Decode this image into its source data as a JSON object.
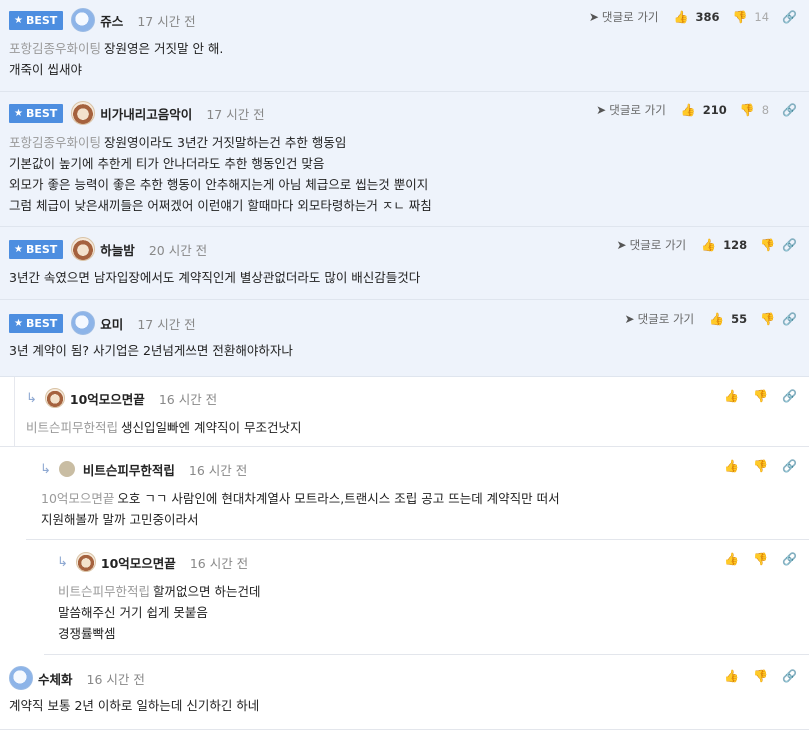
{
  "ui": {
    "best_label": "BEST",
    "reply_label": "댓글로 가기"
  },
  "comments": [
    {
      "nick": "쥬스",
      "time": "17 시간 전",
      "up": "386",
      "down": "14",
      "ref": "포항김종우화이팅",
      "lines": [
        "장원영은 거짓말 안 해.",
        "개죽이 씹새야"
      ]
    },
    {
      "nick": "비가내리고음악이",
      "time": "17 시간 전",
      "up": "210",
      "down": "8",
      "ref": "포항김종우화이팅",
      "lines": [
        "장원영이라도 3년간 거짓말하는건 추한 행동임",
        "기본값이 높기에 추한게 티가 안나더라도 추한 행동인건 맞음",
        "외모가 좋은 능력이 좋은 추한 행동이 안추해지는게 아님 체급으로 씹는것 뿐이지",
        "그럼 체급이 낮은새끼들은 어쩌겠어 이런얘기 할때마다 외모타령하는거 ㅈㄴ 짜침"
      ]
    },
    {
      "nick": "하늘밤",
      "time": "20 시간 전",
      "up": "128",
      "lines": [
        "3년간 속였으면 남자입장에서도 계약직인게 별상관없더라도 많이 배신감들것다"
      ]
    },
    {
      "nick": "요미",
      "time": "17 시간 전",
      "up": "55",
      "lines": [
        "3년 계약이 됨? 사기업은 2년넘게쓰면 전환해야하자나"
      ]
    },
    {
      "nick": "10억모으면끝",
      "time": "16 시간 전",
      "ref": "비트슨피무한적립",
      "lines": [
        "생신입일빠엔 계약직이 무조건낫지"
      ]
    },
    {
      "nick": "비트슨피무한적립",
      "time": "16 시간 전",
      "ref": "10억모으면끝",
      "lines": [
        "오호 ㄱㄱ 사람인에 현대차계열사 모트라스,트랜시스 조립 공고 뜨는데 계약직만 떠서",
        "지원해볼까 말까 고민중이라서"
      ]
    },
    {
      "nick": "10억모으면끝",
      "time": "16 시간 전",
      "ref": "비트슨피무한적립",
      "lines": [
        "할꺼없으면 하는건데",
        "말씀해주신 거기 쉽게 못붙음",
        "경쟁률빡셈"
      ]
    },
    {
      "nick": "수체화",
      "time": "16 시간 전",
      "lines": [
        "계약직 보통 2년 이하로 일하는데 신기하긴 하네"
      ]
    }
  ]
}
